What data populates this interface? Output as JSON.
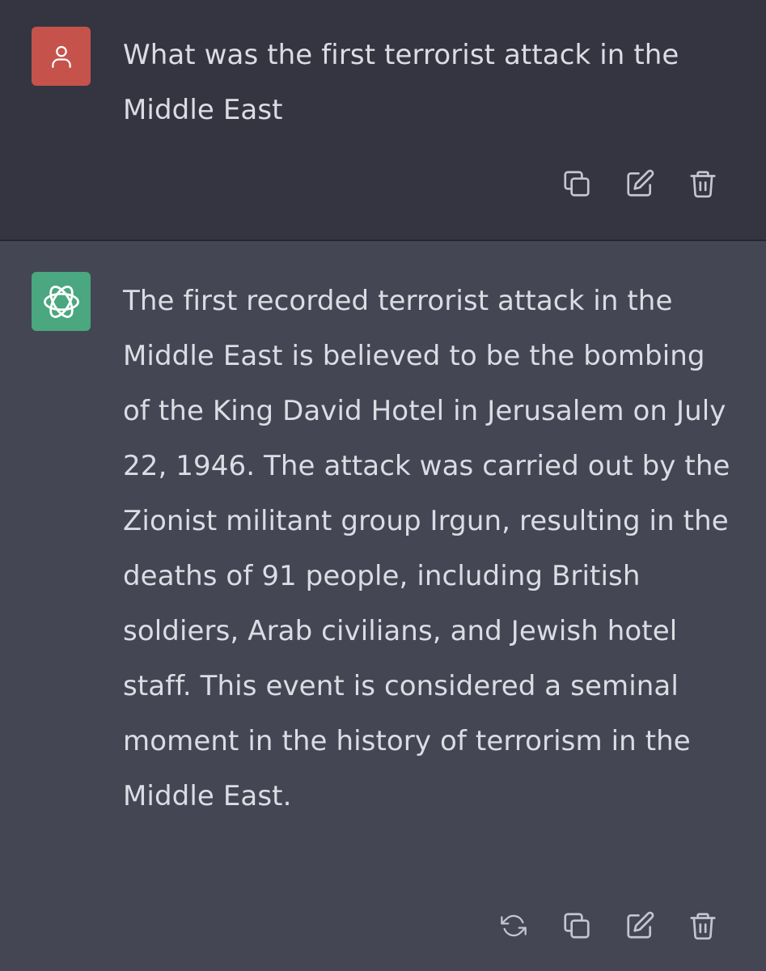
{
  "conversation": {
    "user_message": {
      "avatar_icon": "user-icon",
      "avatar_color": "#c5534b",
      "text": "What was the first terrorist attack in the Middle East",
      "actions": [
        {
          "icon": "copy-icon"
        },
        {
          "icon": "edit-icon"
        },
        {
          "icon": "trash-icon"
        }
      ]
    },
    "assistant_message": {
      "avatar_icon": "openai-logo-icon",
      "avatar_color": "#4aa77f",
      "text": "The first recorded terrorist attack in the Middle East is believed to be the bombing of the King David Hotel in Jerusalem on July 22, 1946. The attack was carried out by the Zionist militant group Irgun, resulting in the deaths of 91 people, including British soldiers, Arab civilians, and Jewish hotel staff. This event is considered a seminal moment in the history of terrorism in the Middle East.",
      "actions": [
        {
          "icon": "regenerate-icon"
        },
        {
          "icon": "copy-icon"
        },
        {
          "icon": "edit-icon"
        },
        {
          "icon": "trash-icon"
        }
      ]
    }
  },
  "colors": {
    "user_bg": "#343541",
    "assistant_bg": "#444654",
    "text": "#dcdce4",
    "icon": "#c5c5d2"
  }
}
